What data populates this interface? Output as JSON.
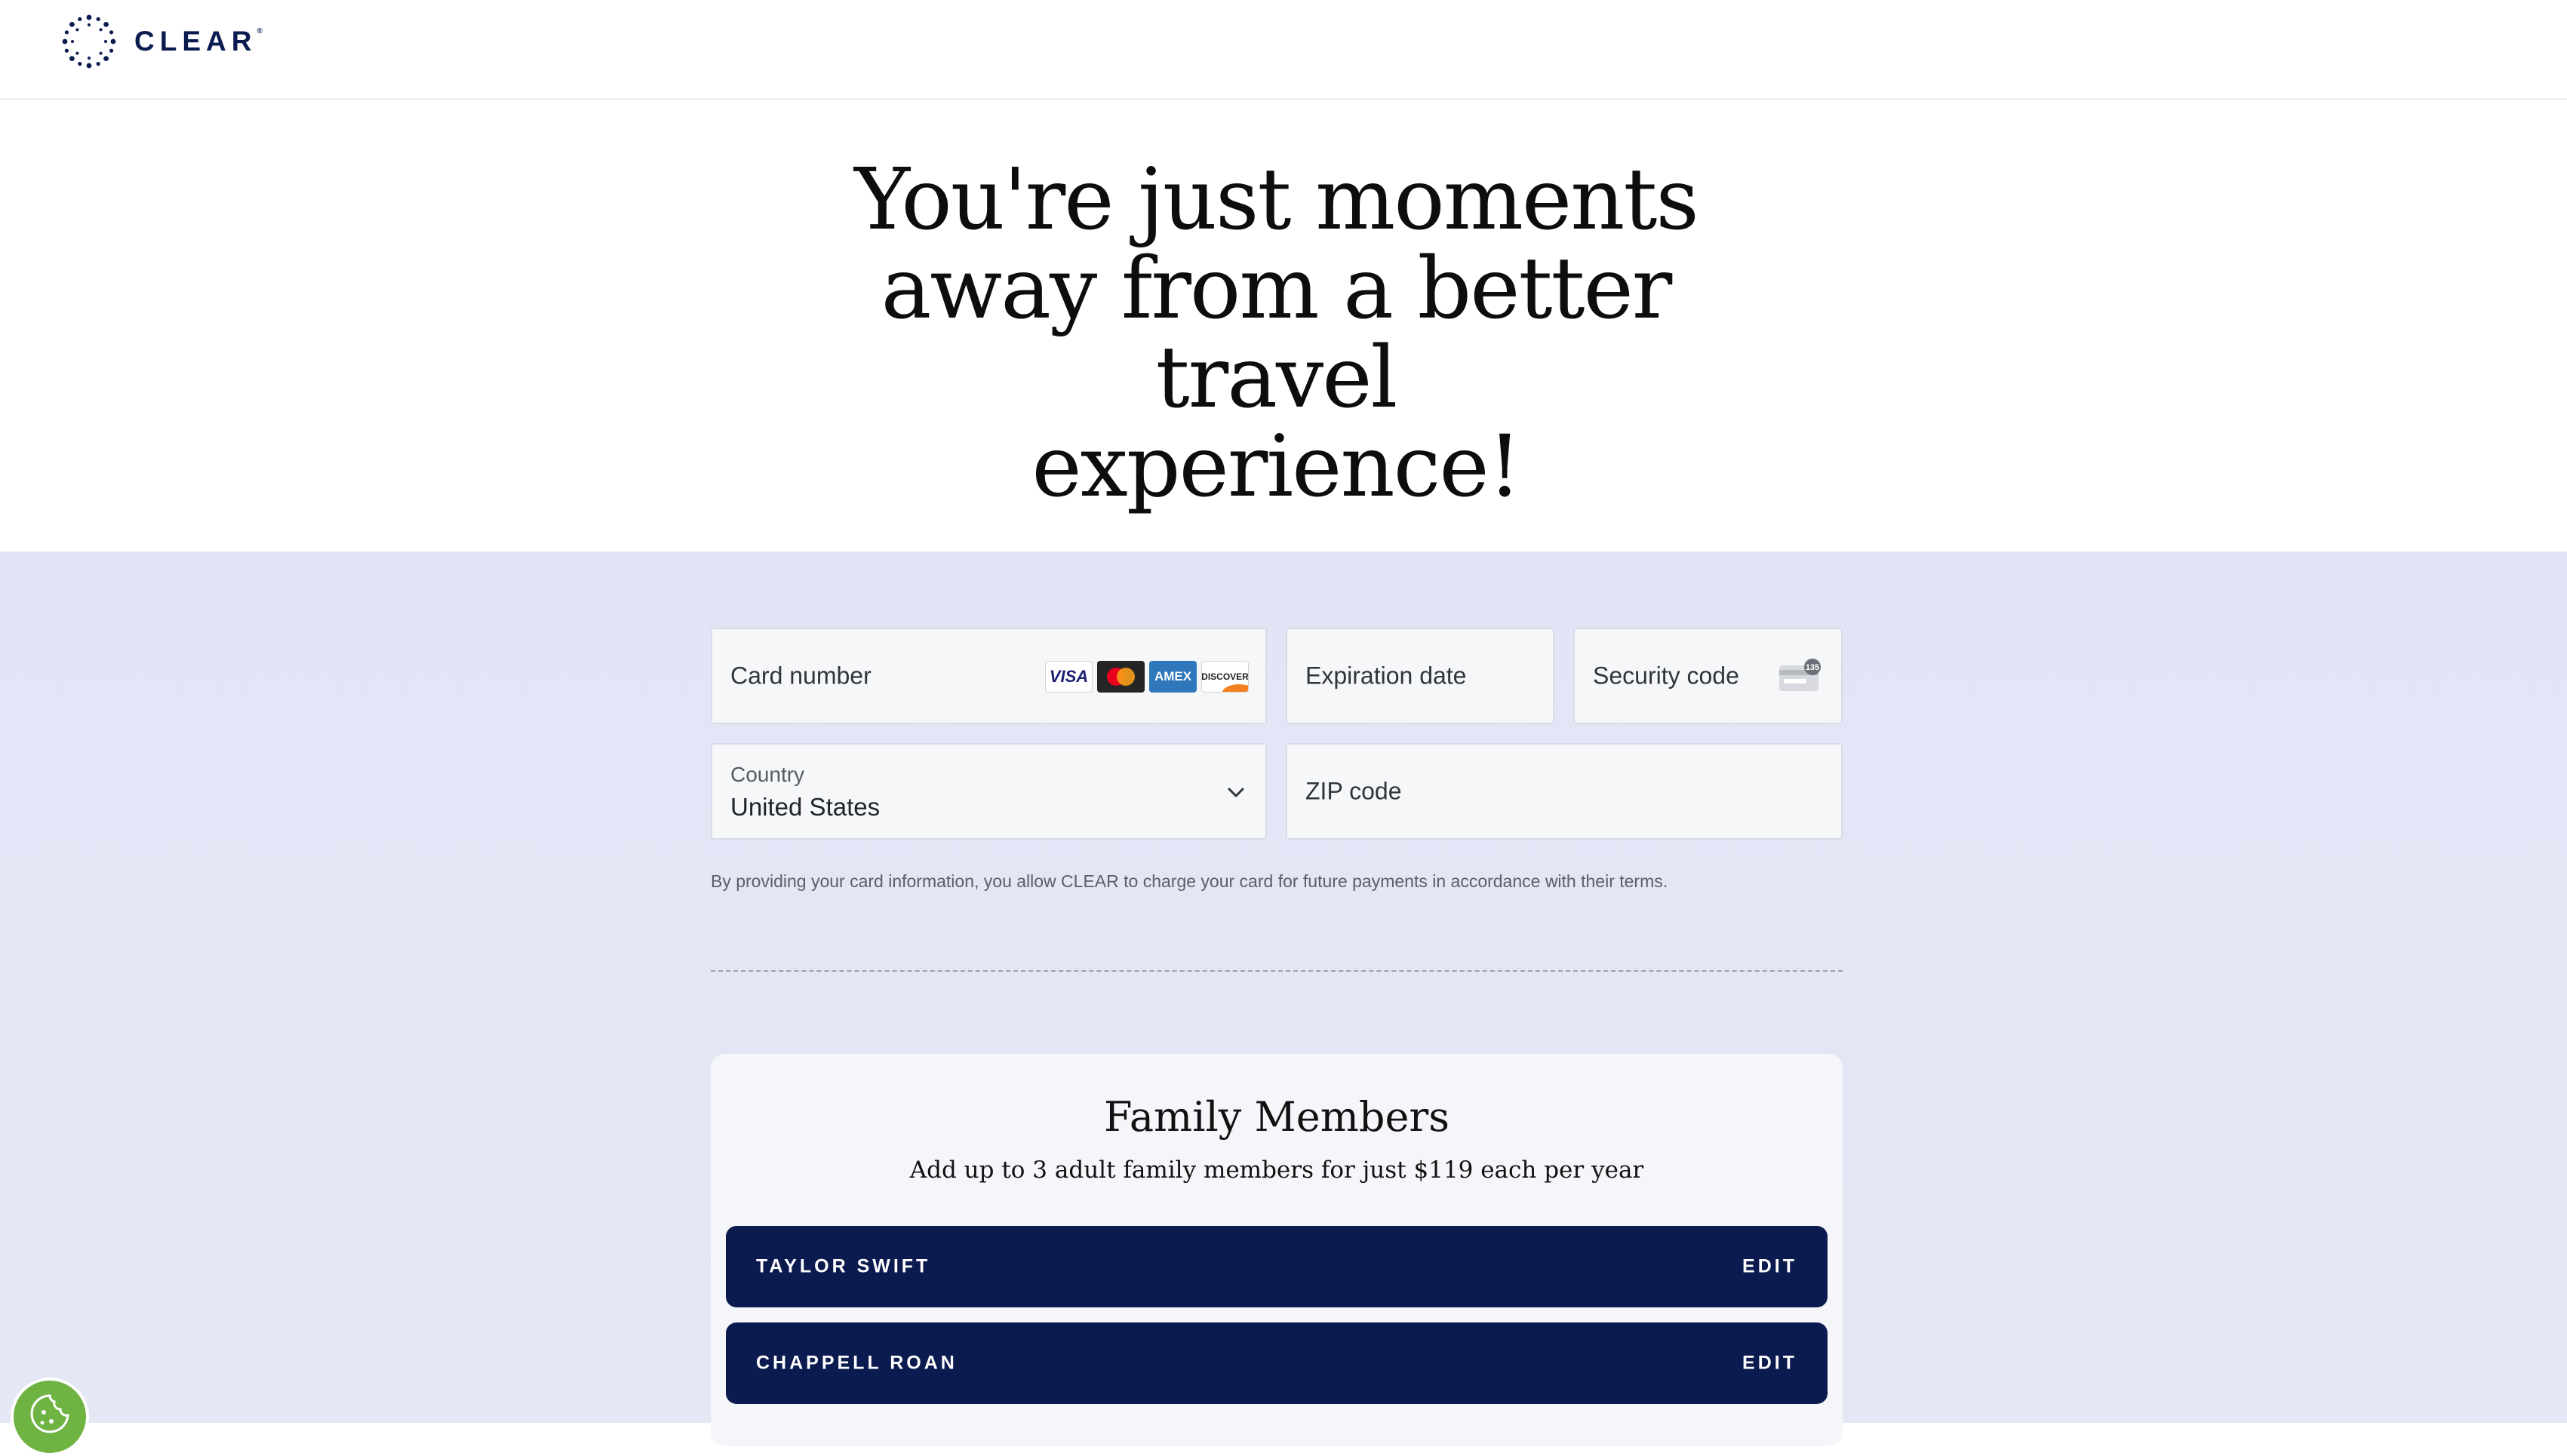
{
  "brand": {
    "name": "CLEAR",
    "trademark": "®"
  },
  "hero": {
    "heading_line1": "You're just moments",
    "heading_line2": "away from a better travel",
    "heading_line3": "experience!"
  },
  "payment": {
    "card_number_placeholder": "Card number",
    "card_brands": [
      "VISA",
      "mastercard",
      "AMEX",
      "DISCOVER"
    ],
    "expiration_placeholder": "Expiration date",
    "security_code_placeholder": "Security code",
    "cvc_hint": "135",
    "country_label": "Country",
    "country_value": "United States",
    "zip_placeholder": "ZIP code",
    "terms": "By providing your card information, you allow CLEAR to charge your card for future payments in accordance with their terms."
  },
  "family": {
    "title": "Family Members",
    "subtitle": "Add up to 3 adult family members for just $119 each per year",
    "members": [
      {
        "name": "TAYLOR SWIFT",
        "action": "EDIT"
      },
      {
        "name": "CHAPPELL ROAN",
        "action": "EDIT"
      }
    ]
  },
  "colors": {
    "brand_navy": "#0b1b4f",
    "band_bg": "#e1e5f6",
    "cookie_green": "#6fb443"
  },
  "icons": {
    "logo": "clear-dots-icon",
    "chevron": "chevron-down-icon",
    "cvc": "credit-card-back-icon",
    "cookie": "cookie-icon"
  }
}
